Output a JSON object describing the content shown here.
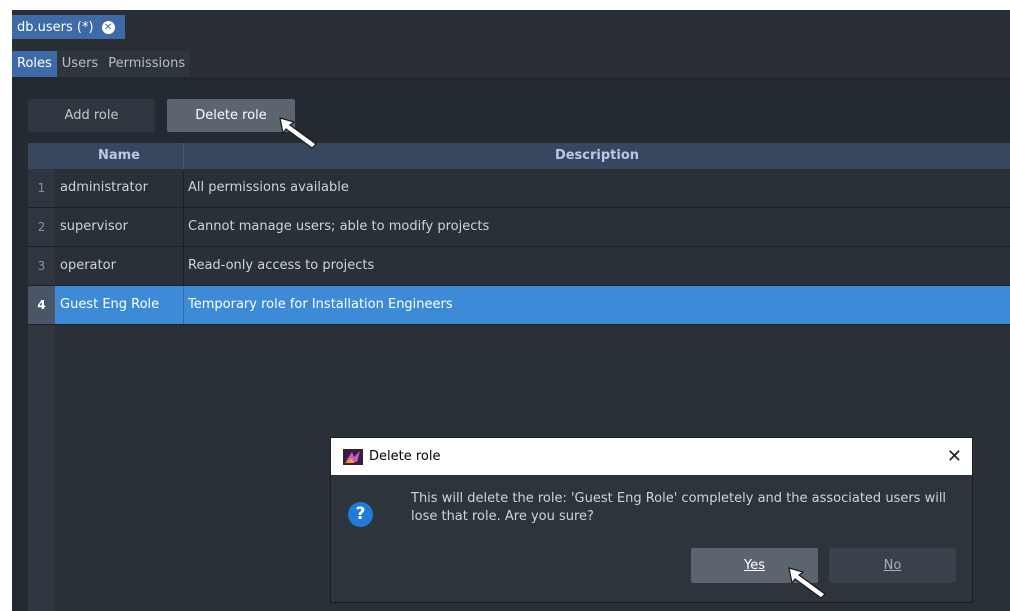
{
  "document_tab": {
    "title": "db.users (*)"
  },
  "subtabs": [
    {
      "label": "Roles",
      "active": true
    },
    {
      "label": "Users",
      "active": false
    },
    {
      "label": "Permissions",
      "active": false
    }
  ],
  "toolbar": {
    "add_label": "Add role",
    "delete_label": "Delete role"
  },
  "table": {
    "columns": [
      "Name",
      "Description"
    ],
    "rows": [
      {
        "num": "1",
        "name": "administrator",
        "description": "All permissions available"
      },
      {
        "num": "2",
        "name": "supervisor",
        "description": "Cannot manage users; able to modify projects"
      },
      {
        "num": "3",
        "name": "operator",
        "description": "Read-only access to projects"
      },
      {
        "num": "4",
        "name": "Guest Eng Role",
        "description": "Temporary role for Installation Engineers",
        "selected": true
      }
    ]
  },
  "dialog": {
    "title": "Delete role",
    "message": "This will delete the role: 'Guest Eng Role' completely and the associated users will lose that role. Are you sure?",
    "yes_label": "Yes",
    "no_label": "No"
  },
  "colors": {
    "accent": "#3e6aa8",
    "selection": "#3d8ad6",
    "background": "#2a2f36",
    "question_icon": "#1f7ad8"
  },
  "icons": [
    "close-circle-icon",
    "app-logo-icon",
    "question-icon",
    "close-icon",
    "mouse-pointer-icon"
  ]
}
